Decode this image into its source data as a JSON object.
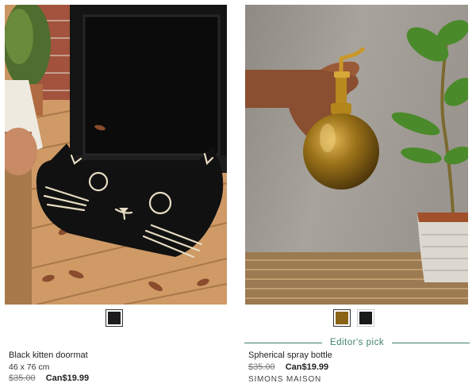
{
  "products": [
    {
      "name": "Black kitten doormat",
      "dimensions": "46 x 76 cm",
      "price_old": "$35.00",
      "price_new": "Can$19.99",
      "swatches": [
        {
          "color": "#1c1c1c",
          "selected": true
        }
      ],
      "image": "black-cat-doormat-photo"
    },
    {
      "badge": "Editor's pick",
      "name": "Spherical spray bottle",
      "price_old": "$35.00",
      "price_new": "Can$19.99",
      "brand": "SIMONS MAISON",
      "swatches": [
        {
          "color": "#8a6416",
          "selected": true
        },
        {
          "color": "#1a1a1a",
          "selected": false
        }
      ],
      "image": "brass-spray-bottle-photo"
    }
  ],
  "colors": {
    "accent": "#3f7f6f"
  }
}
